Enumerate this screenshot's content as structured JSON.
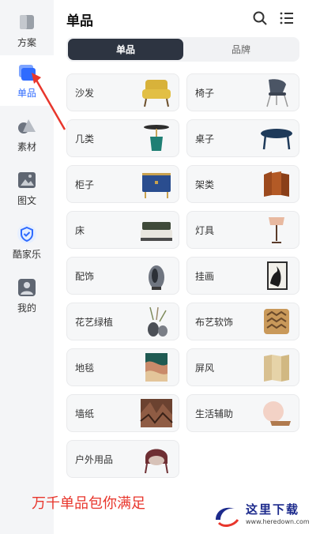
{
  "sidebar": {
    "items": [
      {
        "label": "方案",
        "icon": "cube-icon"
      },
      {
        "label": "单品",
        "icon": "layers-icon",
        "active": true
      },
      {
        "label": "素材",
        "icon": "shapes-icon"
      },
      {
        "label": "图文",
        "icon": "image-icon"
      },
      {
        "label": "酷家乐",
        "icon": "shield-logo-icon"
      },
      {
        "label": "我的",
        "icon": "user-icon"
      }
    ]
  },
  "header": {
    "title": "单品",
    "search_icon": "search-icon",
    "list_icon": "list-icon"
  },
  "tabs": [
    {
      "label": "单品",
      "active": true
    },
    {
      "label": "品牌",
      "active": false
    }
  ],
  "categories": [
    {
      "label": "沙发"
    },
    {
      "label": "椅子"
    },
    {
      "label": "几类"
    },
    {
      "label": "桌子"
    },
    {
      "label": "柜子"
    },
    {
      "label": "架类"
    },
    {
      "label": "床"
    },
    {
      "label": "灯具"
    },
    {
      "label": "配饰"
    },
    {
      "label": "挂画"
    },
    {
      "label": "花艺绿植"
    },
    {
      "label": "布艺软饰"
    },
    {
      "label": "地毯"
    },
    {
      "label": "屏风"
    },
    {
      "label": "墙纸"
    },
    {
      "label": "生活辅助"
    },
    {
      "label": "户外用品"
    }
  ],
  "footer": {
    "promo": "万千单品包你满足",
    "watermark": "这里下载",
    "watermark_url": "www.heredown.com"
  },
  "colors": {
    "accent": "#2f6bff",
    "promo": "#e8362c",
    "tab_active": "#2d3441",
    "arrow": "#e8362c"
  }
}
